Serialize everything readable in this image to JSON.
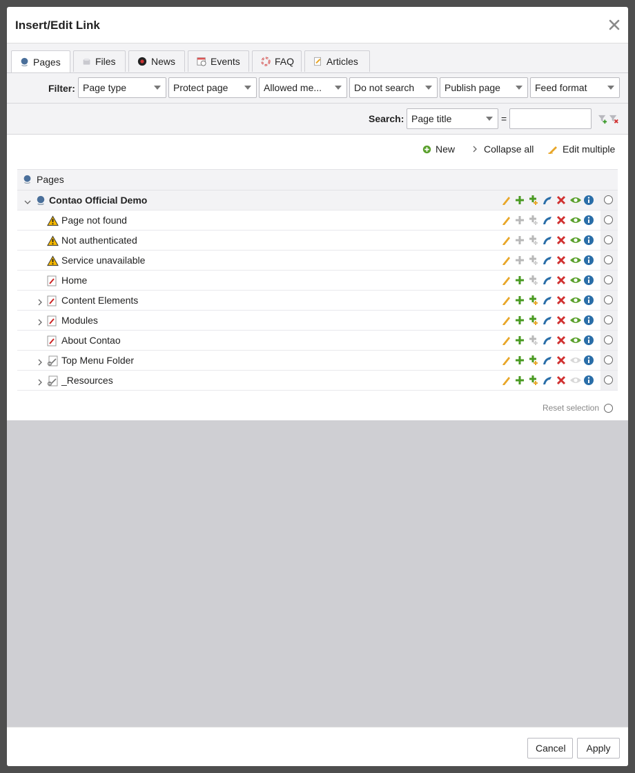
{
  "modal": {
    "title": "Insert/Edit Link"
  },
  "tabs": [
    {
      "label": "Pages",
      "icon": "globe-icon"
    },
    {
      "label": "Files",
      "icon": "files-icon"
    },
    {
      "label": "News",
      "icon": "news-icon"
    },
    {
      "label": "Events",
      "icon": "calendar-icon"
    },
    {
      "label": "FAQ",
      "icon": "lifebuoy-icon"
    },
    {
      "label": "Articles",
      "icon": "article-icon"
    }
  ],
  "filter": {
    "label": "Filter:",
    "selects": [
      "Page type",
      "Protect page",
      "Allowed me...",
      "Do not search",
      "Publish page",
      "Feed format"
    ]
  },
  "search": {
    "label": "Search:",
    "field": "Page title",
    "operator": "=",
    "value": ""
  },
  "operations": {
    "new": "New",
    "collapse": "Collapse all",
    "edit_multiple": "Edit multiple"
  },
  "tree": {
    "header": "Pages",
    "rows": [
      {
        "label": "Contao Official Demo",
        "type": "root",
        "toggle": "expanded"
      },
      {
        "label": "Page not found",
        "type": "error",
        "toggle": ""
      },
      {
        "label": "Not authenticated",
        "type": "error",
        "toggle": ""
      },
      {
        "label": "Service unavailable",
        "type": "error",
        "toggle": ""
      },
      {
        "label": "Home",
        "type": "regular",
        "toggle": ""
      },
      {
        "label": "Content Elements",
        "type": "regular",
        "toggle": "collapsed"
      },
      {
        "label": "Modules",
        "type": "regular",
        "toggle": "collapsed"
      },
      {
        "label": "About Contao",
        "type": "regular",
        "toggle": ""
      },
      {
        "label": "Top Menu Folder",
        "type": "folder",
        "toggle": "collapsed"
      },
      {
        "label": "_Resources",
        "type": "folder",
        "toggle": "collapsed"
      }
    ],
    "reset": "Reset selection"
  },
  "footer": {
    "cancel": "Cancel",
    "apply": "Apply"
  },
  "colors": {
    "accent_green": "#5aa02c",
    "delete_red": "#d03030",
    "info_blue": "#2a6ea8",
    "edit_orange": "#e8a628",
    "panel_grey": "#f3f3f5",
    "frame_grey": "#cfcfd3"
  }
}
